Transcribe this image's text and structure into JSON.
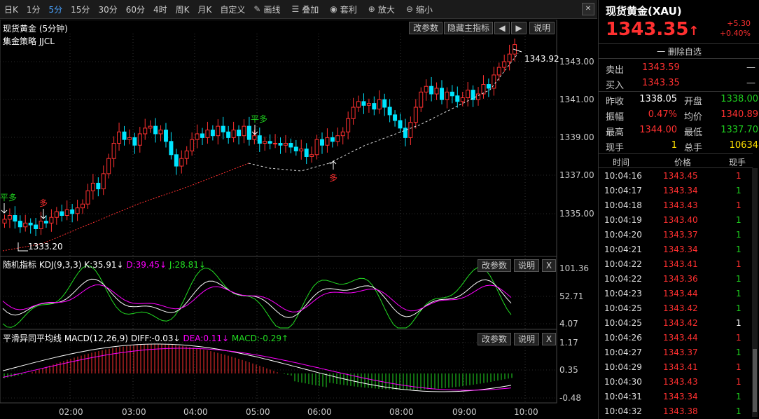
{
  "toolbar": {
    "periods": [
      "日K",
      "1分",
      "5分",
      "15分",
      "30分",
      "60分",
      "4时",
      "周K",
      "月K",
      "自定义"
    ],
    "active": "5分",
    "tools": [
      {
        "label": "画线",
        "icon": "pencil-icon"
      },
      {
        "label": "叠加",
        "icon": "layers-icon"
      },
      {
        "label": "套利",
        "icon": "money-bag-icon"
      },
      {
        "label": "放大",
        "icon": "zoom-in-icon"
      },
      {
        "label": "缩小",
        "icon": "zoom-out-icon"
      }
    ],
    "close": "✕"
  },
  "main": {
    "title": "现货黄金 (5分钟)",
    "strategy": "集金策略 JJCL",
    "buttons": {
      "params": "改参数",
      "hide": "隐藏主指标",
      "prev": "🡄",
      "next": "🡆",
      "help": "说明"
    },
    "yticks": [
      "1343.00",
      "1341.00",
      "1339.00",
      "1337.00",
      "1335.00"
    ],
    "last_label": "1343.92",
    "low_label": "1333.20",
    "signals": [
      {
        "text": "平多",
        "color": "#1fd21f"
      },
      {
        "text": "多",
        "color": "#ff3030"
      },
      {
        "text": "平多",
        "color": "#1fd21f"
      },
      {
        "text": "多",
        "color": "#ff3030"
      }
    ]
  },
  "kdj": {
    "title": "随机指标",
    "params": "KDJ(9,3,3)",
    "k": "K:35.91↓",
    "d": "D:39.45↓",
    "j": "J:28.81↓",
    "yticks": [
      "101.36",
      "52.71",
      "4.07"
    ],
    "buttons": {
      "params": "改参数",
      "help": "说明",
      "close": "X"
    }
  },
  "macd": {
    "title": "平滑异同平均线",
    "params": "MACD(12,26,9)",
    "diff": "DIFF:-0.03↓",
    "dea": "DEA:0.11↓",
    "macd": "MACD:-0.29↑",
    "yticks": [
      "1.17",
      "0.35",
      "-0.48"
    ],
    "buttons": {
      "params": "改参数",
      "help": "说明",
      "close": "X"
    }
  },
  "xaxis": [
    "02:00",
    "03:00",
    "04:00",
    "05:00",
    "06:00",
    "08:00",
    "09:00",
    "10:00"
  ],
  "quote": {
    "name": "现货黄金(XAU)",
    "price": "1343.35",
    "arrow": "↑",
    "change": "+5.30",
    "change_pct": "+0.40%",
    "delete": "一 删除自选",
    "sell_label": "卖出",
    "sell": "1343.59",
    "sell_vol": "—",
    "buy_label": "买入",
    "buy": "1343.35",
    "buy_vol": "—",
    "rows": [
      {
        "l1": "昨收",
        "v1": "1338.05",
        "c1": "white",
        "l2": "开盘",
        "v2": "1338.00",
        "c2": "green"
      },
      {
        "l1": "振幅",
        "v1": "0.47%",
        "c1": "red",
        "l2": "均价",
        "v2": "1340.89",
        "c2": "red"
      },
      {
        "l1": "最高",
        "v1": "1344.00",
        "c1": "red",
        "l2": "最低",
        "v2": "1337.70",
        "c2": "green"
      },
      {
        "l1": "现手",
        "v1": "1",
        "c1": "yellow",
        "l2": "总手",
        "v2": "10634",
        "c2": "yellow"
      }
    ],
    "trade_headers": [
      "时间",
      "价格",
      "现手"
    ],
    "trades": [
      [
        "10:04:16",
        "1343.45",
        "1"
      ],
      [
        "10:04:17",
        "1343.34",
        "1"
      ],
      [
        "10:04:18",
        "1343.43",
        "1"
      ],
      [
        "10:04:19",
        "1343.40",
        "1"
      ],
      [
        "10:04:20",
        "1343.37",
        "1"
      ],
      [
        "10:04:21",
        "1343.34",
        "1"
      ],
      [
        "10:04:22",
        "1343.41",
        "1"
      ],
      [
        "10:04:22",
        "1343.36",
        "1"
      ],
      [
        "10:04:23",
        "1343.44",
        "1"
      ],
      [
        "10:04:25",
        "1343.42",
        "1"
      ],
      [
        "10:04:25",
        "1343.42",
        "1"
      ],
      [
        "10:04:26",
        "1343.44",
        "1"
      ],
      [
        "10:04:27",
        "1343.37",
        "1"
      ],
      [
        "10:04:29",
        "1343.41",
        "1"
      ],
      [
        "10:04:30",
        "1343.43",
        "1"
      ],
      [
        "10:04:31",
        "1343.34",
        "1"
      ],
      [
        "10:04:32",
        "1343.38",
        "1"
      ]
    ],
    "trade_vol_colors": [
      "red",
      "green",
      "red",
      "green",
      "green",
      "green",
      "red",
      "green",
      "green",
      "green",
      "white",
      "red",
      "green",
      "red",
      "red",
      "green",
      "green"
    ]
  },
  "colors": {
    "up": "#ff3030",
    "down": "#00e5ff",
    "kline_down_fill": "#00e5ff",
    "k": "#ffffff",
    "d": "#ff00ff",
    "j": "#22dd22",
    "diff": "#ffffff",
    "dea": "#ff00ff"
  }
}
